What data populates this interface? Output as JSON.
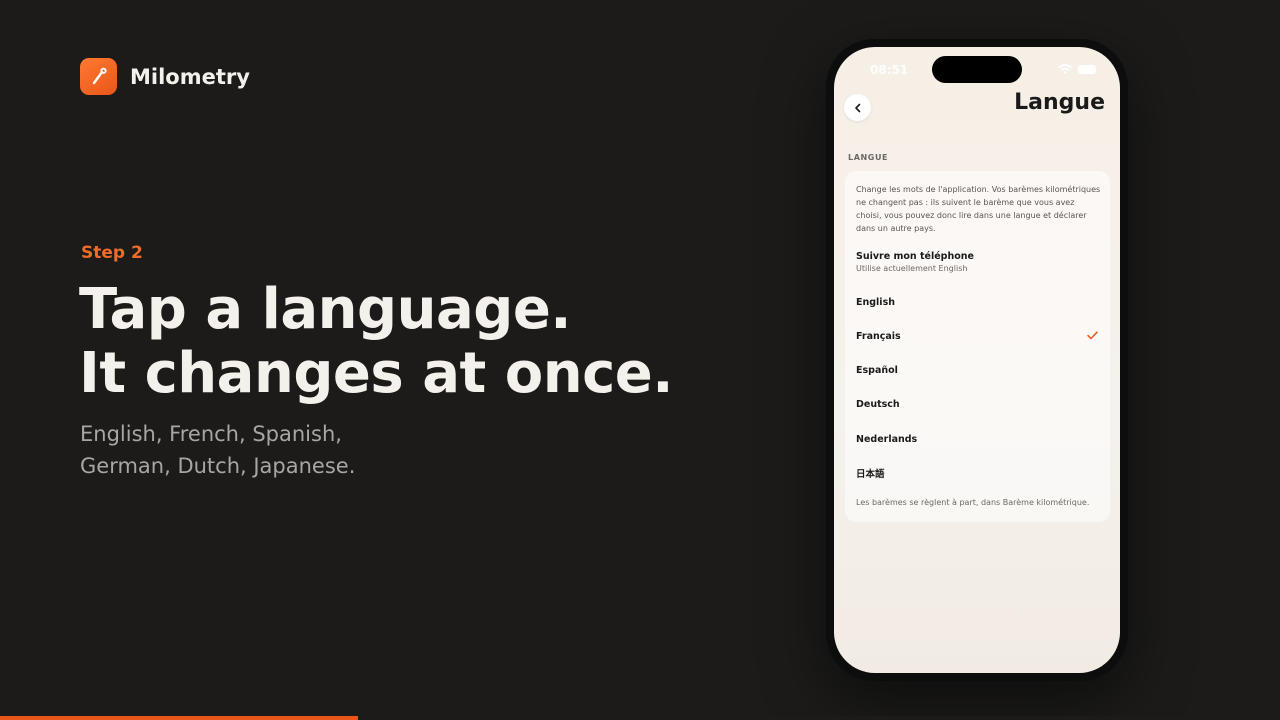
{
  "brand": {
    "name": "Milometry",
    "logo_icon": "pen-icon",
    "accent": "#e9561a"
  },
  "slide": {
    "step": "Step 2",
    "headline": [
      "Tap a language.",
      "It changes at once."
    ],
    "subtitle": [
      "English, French, Spanish,",
      "German, Dutch, Japanese."
    ],
    "progress": 0.28
  },
  "phone": {
    "status_time": "08:51",
    "title": "Langue",
    "section_label": "LANGUE",
    "description": "Change les mots de l'application. Vos barèmes kilométriques ne changent pas : ils suivent le barème que vous avez choisi, vous pouvez donc lire dans une langue et déclarer dans un autre pays.",
    "system_option": {
      "title": "Suivre mon téléphone",
      "subtitle": "Utilise actuellement English"
    },
    "languages": [
      {
        "label": "English",
        "selected": false
      },
      {
        "label": "Français",
        "selected": true
      },
      {
        "label": "Español",
        "selected": false
      },
      {
        "label": "Deutsch",
        "selected": false
      },
      {
        "label": "Nederlands",
        "selected": false
      },
      {
        "label": "日本語",
        "selected": false
      }
    ],
    "footer": "Les barèmes se règlent à part, dans Barème kilométrique."
  }
}
